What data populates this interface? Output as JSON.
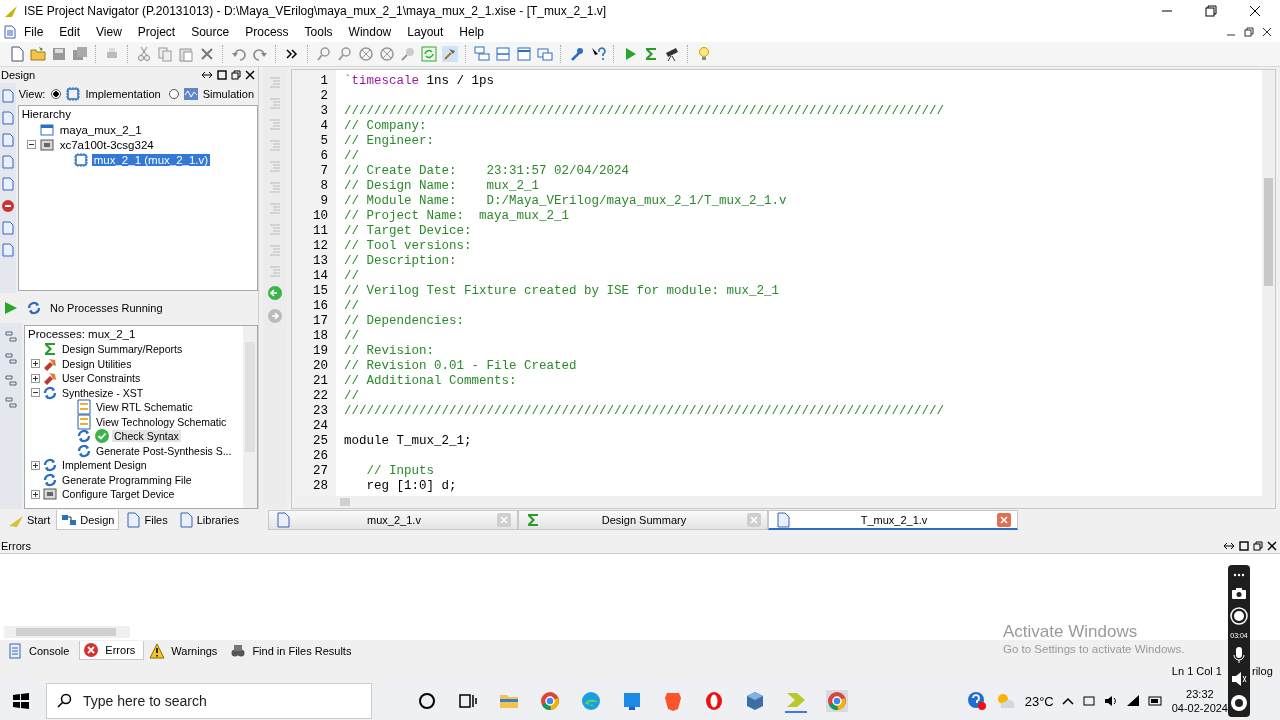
{
  "window": {
    "title": "ISE Project Navigator (P.20131013) - D:\\Maya_VErilog\\maya_mux_2_1\\maya_mux_2_1.xise - [T_mux_2_1.v]"
  },
  "menu": [
    "File",
    "Edit",
    "View",
    "Project",
    "Source",
    "Process",
    "Tools",
    "Window",
    "Layout",
    "Help"
  ],
  "design_panel": {
    "title": "Design",
    "view_label": "View:",
    "view_options": [
      {
        "label": "Implementation",
        "kind": "chip",
        "selected": true
      },
      {
        "label": "Simulation",
        "kind": "wave",
        "selected": false
      }
    ],
    "hierarchy": {
      "title": "Hierarchy",
      "items": [
        {
          "label": "maya_mux_2_1",
          "kind": "project",
          "selected": false
        },
        {
          "label": "xc7a100t-3csg324",
          "kind": "device",
          "expanded": true,
          "selected": false,
          "children": [
            {
              "label": "mux_2_1 (mux_2_1.v)",
              "kind": "module",
              "selected": true
            }
          ]
        }
      ]
    }
  },
  "process_status": "No Processes Running",
  "processes": {
    "title": "Processes: mux_2_1",
    "items": [
      {
        "label": "Design Summary/Reports",
        "kind": "summary",
        "done": false,
        "selected": false
      },
      {
        "label": "Design Utilities",
        "kind": "tools",
        "expanded": false,
        "done": false,
        "selected": false
      },
      {
        "label": "User Constraints",
        "kind": "tools",
        "expanded": false,
        "done": false,
        "selected": false
      },
      {
        "label": "Synthesize - XST",
        "kind": "process",
        "expanded": true,
        "done": false,
        "selected": false,
        "children": [
          {
            "label": "View RTL Schematic",
            "kind": "schematic",
            "done": false,
            "selected": false
          },
          {
            "label": "View Technology Schematic",
            "kind": "schematic",
            "done": false,
            "selected": false
          },
          {
            "label": "Check Syntax",
            "kind": "process",
            "done": true,
            "selected": true
          },
          {
            "label": "Generate Post-Synthesis S...",
            "kind": "process",
            "done": false,
            "selected": false
          }
        ]
      },
      {
        "label": "Implement Design",
        "kind": "process",
        "expanded": false,
        "done": false,
        "selected": false
      },
      {
        "label": "Generate Programming File",
        "kind": "process",
        "done": false,
        "selected": false
      },
      {
        "label": "Configure Target Device",
        "kind": "device",
        "expanded": false,
        "done": false,
        "selected": false
      }
    ]
  },
  "panel_tabs": [
    {
      "label": "Start",
      "kind": "start",
      "selected": false
    },
    {
      "label": "Design",
      "kind": "design",
      "selected": true
    },
    {
      "label": "Files",
      "kind": "file",
      "selected": false
    },
    {
      "label": "Libraries",
      "kind": "file",
      "selected": false
    }
  ],
  "editor": {
    "lines": [
      {
        "num": "1",
        "parts": [
          {
            "kind": "directive",
            "text": "`timescale"
          },
          {
            "kind": "plain",
            "text": " 1ns / 1ps"
          }
        ]
      },
      {
        "num": "2"
      },
      {
        "num": "3",
        "parts": [
          {
            "kind": "comment",
            "text": "////////////////////////////////////////////////////////////////////////////////"
          }
        ]
      },
      {
        "num": "4",
        "parts": [
          {
            "kind": "comment",
            "text": "// Company: "
          }
        ]
      },
      {
        "num": "5",
        "parts": [
          {
            "kind": "comment",
            "text": "// Engineer:"
          }
        ]
      },
      {
        "num": "6",
        "parts": [
          {
            "kind": "comment",
            "text": "//"
          }
        ]
      },
      {
        "num": "7",
        "parts": [
          {
            "kind": "comment",
            "text": "// Create Date:    23:31:57 02/04/2024 "
          }
        ]
      },
      {
        "num": "8",
        "parts": [
          {
            "kind": "comment",
            "text": "// Design Name:    mux_2_1"
          }
        ]
      },
      {
        "num": "9",
        "parts": [
          {
            "kind": "comment",
            "text": "// Module Name:    D:/Maya_VErilog/maya_mux_2_1/T_mux_2_1.v"
          }
        ]
      },
      {
        "num": "10",
        "parts": [
          {
            "kind": "comment",
            "text": "// Project Name:  maya_mux_2_1"
          }
        ]
      },
      {
        "num": "11",
        "parts": [
          {
            "kind": "comment",
            "text": "// Target Device:  "
          }
        ]
      },
      {
        "num": "12",
        "parts": [
          {
            "kind": "comment",
            "text": "// Tool versions:  "
          }
        ]
      },
      {
        "num": "13",
        "parts": [
          {
            "kind": "comment",
            "text": "// Description: "
          }
        ]
      },
      {
        "num": "14",
        "parts": [
          {
            "kind": "comment",
            "text": "//"
          }
        ]
      },
      {
        "num": "15",
        "parts": [
          {
            "kind": "comment",
            "text": "// Verilog Test Fixture created by ISE for module: mux_2_1"
          }
        ]
      },
      {
        "num": "16",
        "parts": [
          {
            "kind": "comment",
            "text": "//"
          }
        ]
      },
      {
        "num": "17",
        "parts": [
          {
            "kind": "comment",
            "text": "// Dependencies:"
          }
        ]
      },
      {
        "num": "18",
        "parts": [
          {
            "kind": "comment",
            "text": "// "
          }
        ]
      },
      {
        "num": "19",
        "parts": [
          {
            "kind": "comment",
            "text": "// Revision:"
          }
        ]
      },
      {
        "num": "20",
        "parts": [
          {
            "kind": "comment",
            "text": "// Revision 0.01 - File Created"
          }
        ]
      },
      {
        "num": "21",
        "parts": [
          {
            "kind": "comment",
            "text": "// Additional Comments:"
          }
        ]
      },
      {
        "num": "22",
        "parts": [
          {
            "kind": "comment",
            "text": "// "
          }
        ]
      },
      {
        "num": "23",
        "parts": [
          {
            "kind": "comment",
            "text": "////////////////////////////////////////////////////////////////////////////////"
          }
        ]
      },
      {
        "num": "24"
      },
      {
        "num": "25",
        "parts": [
          {
            "kind": "plain",
            "text": "module T_mux_2_1;"
          }
        ]
      },
      {
        "num": "26"
      },
      {
        "num": "27",
        "parts": [
          {
            "kind": "comment",
            "text": "   // Inputs"
          }
        ]
      },
      {
        "num": "28",
        "parts": [
          {
            "kind": "plain",
            "text": "   reg [1:0] d;"
          }
        ]
      }
    ]
  },
  "editor_tabs": [
    {
      "label": "mux_2_1.v",
      "kind": "file",
      "selected": false
    },
    {
      "label": "Design Summary",
      "kind": "summary",
      "selected": false
    },
    {
      "label": "T_mux_2_1.v",
      "kind": "file",
      "selected": true
    }
  ],
  "errors_panel": {
    "title": "Errors"
  },
  "console_tabs": [
    {
      "label": "Console",
      "kind": "console",
      "selected": false
    },
    {
      "label": "Errors",
      "kind": "error",
      "selected": true
    },
    {
      "label": "Warnings",
      "kind": "warning",
      "selected": false
    },
    {
      "label": "Find in Files Results",
      "kind": "find",
      "selected": false
    }
  ],
  "status_bar": {
    "position": "Ln 1 Col 1",
    "language": "rilog"
  },
  "activation_notice": {
    "title": "Activate Windows",
    "text": "Go to Settings to activate Windows."
  },
  "recorder": {
    "time": "03:04"
  },
  "taskbar": {
    "search": {
      "placeholder": "Type here to search"
    },
    "temperature": "23°C",
    "time": "23:32",
    "date": "04-02-2024"
  }
}
